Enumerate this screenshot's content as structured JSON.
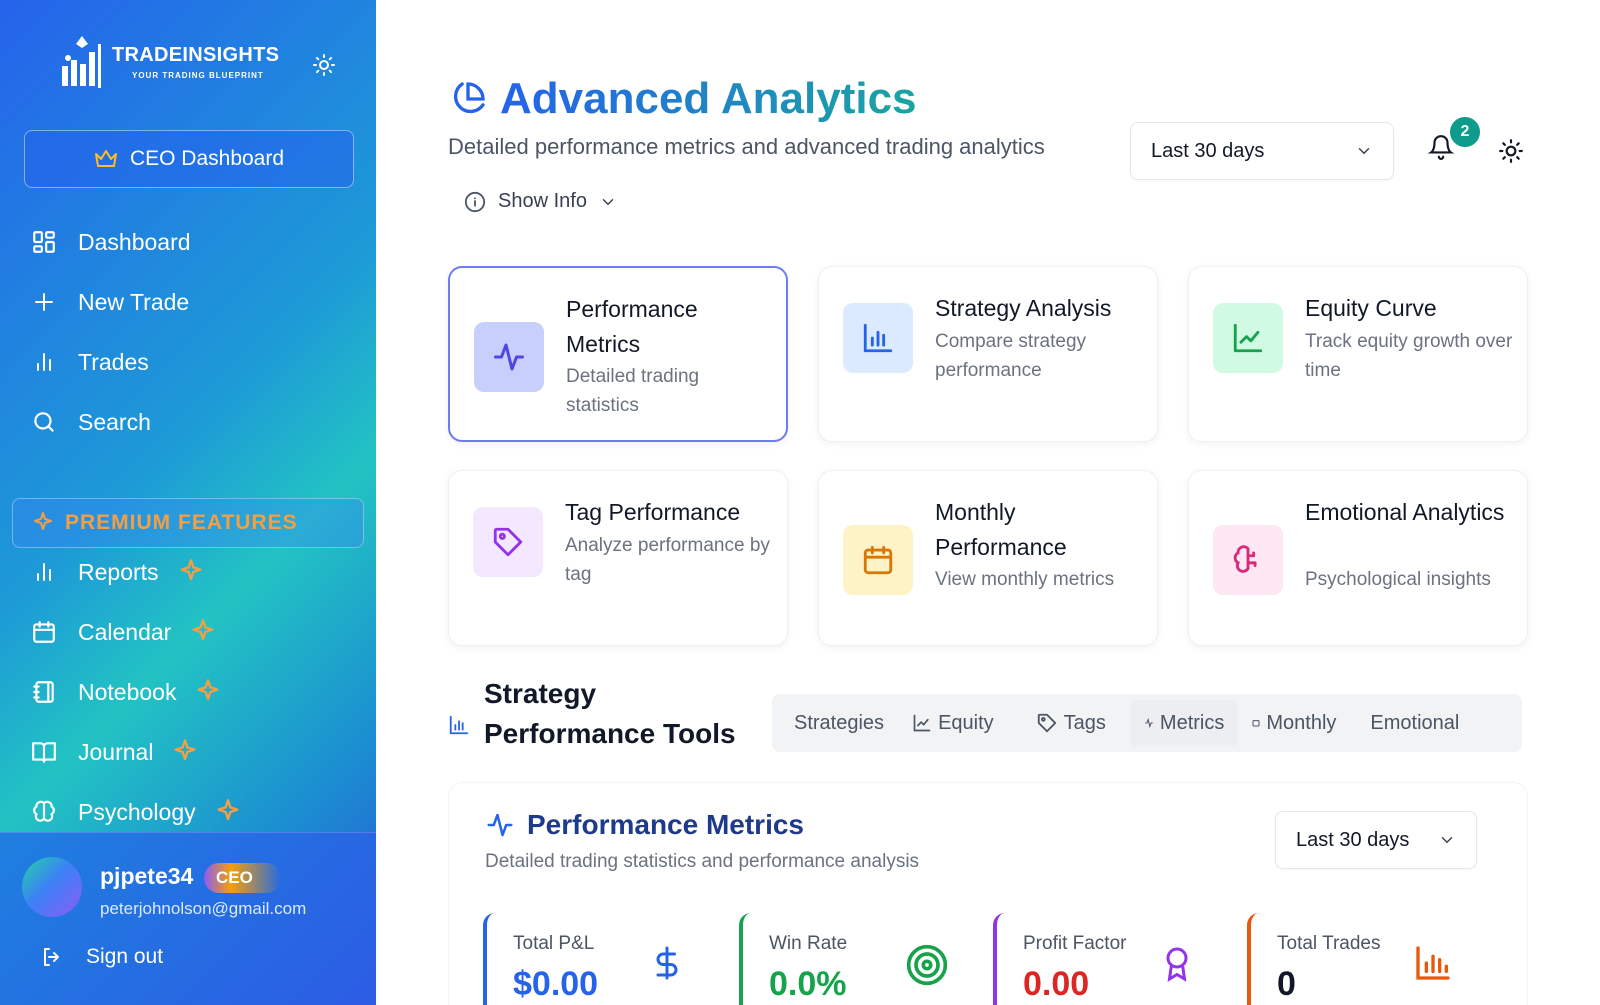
{
  "sidebar": {
    "brand_name": "TRADEINSIGHTS",
    "brand_tagline": "YOUR TRADING BLUEPRINT",
    "ceo_dashboard_label": "CEO Dashboard",
    "nav": [
      {
        "label": "Dashboard",
        "icon": "grid-icon"
      },
      {
        "label": "New Trade",
        "icon": "plus-icon"
      },
      {
        "label": "Trades",
        "icon": "bar-chart-icon"
      },
      {
        "label": "Search",
        "icon": "search-icon"
      }
    ],
    "premium_label": "PREMIUM FEATURES",
    "premium_nav": [
      {
        "label": "Reports",
        "icon": "bar-chart-icon"
      },
      {
        "label": "Calendar",
        "icon": "calendar-icon"
      },
      {
        "label": "Notebook",
        "icon": "notebook-icon"
      },
      {
        "label": "Journal",
        "icon": "book-open-icon"
      },
      {
        "label": "Psychology",
        "icon": "brain-icon"
      }
    ],
    "user": {
      "name": "pjpete34",
      "role": "CEO",
      "email": "peterjohnolson@gmail.com"
    },
    "sign_out_label": "Sign out"
  },
  "header": {
    "title": "Advanced Analytics",
    "subtitle": "Detailed performance metrics and advanced trading analytics",
    "range_select": "Last 30 days",
    "notification_count": "2",
    "show_info_label": "Show Info"
  },
  "cards": [
    {
      "title": "Performance Metrics",
      "desc": "Detailed trading statistics",
      "icon": "activity-icon",
      "color": "#4f46e5",
      "bg": "#c7cffc"
    },
    {
      "title": "Strategy Analysis",
      "desc": "Compare strategy performance",
      "icon": "bar-chart-icon",
      "color": "#2563eb",
      "bg": "#dbeafe"
    },
    {
      "title": "Equity Curve",
      "desc": "Track equity growth over time",
      "icon": "line-chart-icon",
      "color": "#16a34a",
      "bg": "#d1fae5"
    },
    {
      "title": "Tag Performance",
      "desc": "Analyze performance by tag",
      "icon": "tag-icon",
      "color": "#9333ea",
      "bg": "#f3e8ff"
    },
    {
      "title": "Monthly Performance",
      "desc": "View monthly metrics",
      "icon": "calendar-icon",
      "color": "#d97706",
      "bg": "#fef3c7"
    },
    {
      "title": "Emotional Analytics",
      "desc": "Psychological insights",
      "icon": "brain-icon",
      "color": "#db2777",
      "bg": "#fce7f3"
    }
  ],
  "tools": {
    "title": "Strategy Performance Tools",
    "tabs": [
      "Strategies",
      "Equity",
      "Tags",
      "Metrics",
      "Monthly",
      "Emotional"
    ],
    "active_tab": "Metrics"
  },
  "performance_panel": {
    "title": "Performance Metrics",
    "subtitle": "Detailed trading statistics and performance analysis",
    "range_select": "Last 30 days",
    "metrics": [
      {
        "label": "Total P&L",
        "value": "$0.00",
        "color": "#2563eb",
        "icon": "dollar-icon"
      },
      {
        "label": "Win Rate",
        "value": "0.0%",
        "color": "#16a34a",
        "icon": "target-icon"
      },
      {
        "label": "Profit Factor",
        "value": "0.00",
        "color": "#9333ea",
        "icon": "award-icon"
      },
      {
        "label": "Total Trades",
        "value": "0",
        "color": "#ea580c",
        "icon": "bar-chart-icon"
      }
    ]
  }
}
